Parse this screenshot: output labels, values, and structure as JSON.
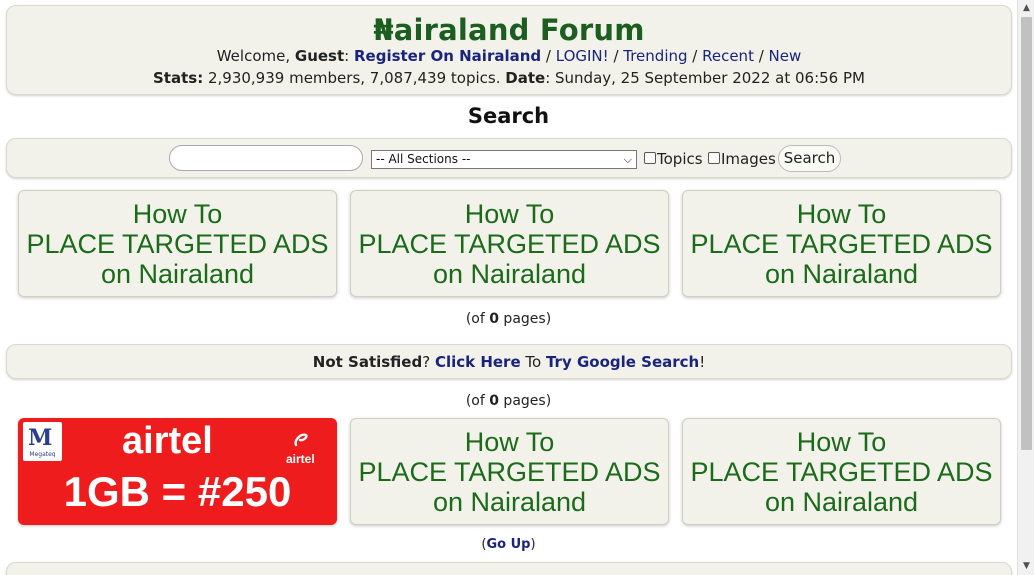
{
  "header": {
    "logo": "₦airaland Forum",
    "welcome_prefix": "Welcome, ",
    "guest": "Guest",
    "colon": ": ",
    "register": "Register On Nairaland",
    "login": "LOGIN!",
    "trending": "Trending",
    "recent": "Recent",
    "new": "New",
    "sep": " / ",
    "stats_label": "Stats:",
    "stats_value": " 2,930,939 members, 7,087,439 topics. ",
    "date_label": "Date",
    "date_value": ": Sunday, 25 September 2022 at 06:56 PM"
  },
  "page_title": "Search",
  "search": {
    "input_value": "",
    "section_selected": "-- All Sections --",
    "topics_label": "Topics",
    "topics_checked": false,
    "images_label": "Images",
    "images_checked": false,
    "button_label": "Search"
  },
  "ads": {
    "line1": "How To",
    "line2": "PLACE TARGETED ADS",
    "line3": "on Nairaland"
  },
  "pages_info": {
    "open": "(of ",
    "count": "0",
    "close": " pages)"
  },
  "not_satisfied": {
    "lead": "Not Satisfied",
    "q": "? ",
    "click_here": "Click Here",
    "to": " To ",
    "try_google": "Try Google Search",
    "bang": "!"
  },
  "airtel_ad": {
    "logo_text": "Megateq",
    "brand": "airtel",
    "brand_small": "airtel",
    "offer": "1GB = #250"
  },
  "go_up": {
    "open": "(",
    "label": "Go Up",
    "close": ")"
  },
  "colors": {
    "logo_green": "#1b5e20",
    "link_blue": "#1a237e",
    "ad_green": "#1b6b1b",
    "box_bg": "#f2f2ea",
    "airtel_red": "#ee1c1c"
  }
}
